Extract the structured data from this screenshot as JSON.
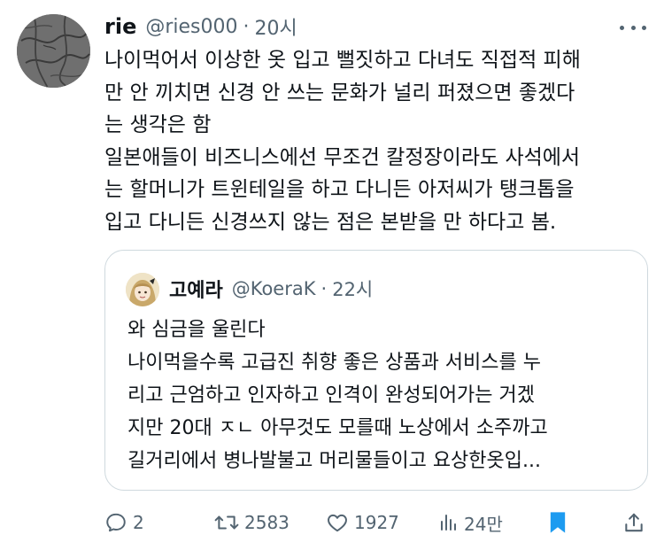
{
  "tweet": {
    "name": "rie",
    "handle": "@ries000",
    "separator": "·",
    "time": "20시",
    "lines": [
      "나이먹어서 이상한 옷 입고 뻘짓하고 다녀도 직접적 피해",
      "만 안 끼치면 신경 안 쓰는 문화가 널리 퍼졌으면 좋겠다",
      "는 생각은 함",
      "일본애들이 비즈니스에선 무조건 칼정장이라도 사석에서",
      "는 할머니가 트윈테일을 하고 다니든 아저씨가 탱크톱을",
      "입고 다니든 신경쓰지 않는 점은 본받을 만 하다고 봄."
    ]
  },
  "quote": {
    "name": "고예라",
    "handle": "@KoeraK",
    "separator": "·",
    "time": "22시",
    "lines": [
      "와 심금을 울린다",
      "나이먹을수록 고급진 취향 좋은 상품과 서비스를 누",
      "리고 근엄하고 인자하고 인격이 완성되어가는 거겠",
      "지만 20대 ㅈㄴ 아무것도 모를때 노상에서 소주까고",
      "길거리에서 병나발불고 머리물들이고 요상한옷입..."
    ]
  },
  "actions": {
    "replies": "2",
    "retweets": "2583",
    "likes": "1927",
    "views": "24만"
  },
  "colors": {
    "text": "#0f1419",
    "secondary": "#536471",
    "border": "#cfd9de",
    "bookmark": "#1d9bf0"
  },
  "icons": [
    "reply-icon",
    "retweet-icon",
    "like-icon",
    "views-icon",
    "bookmark-icon",
    "share-icon",
    "more-icon"
  ]
}
